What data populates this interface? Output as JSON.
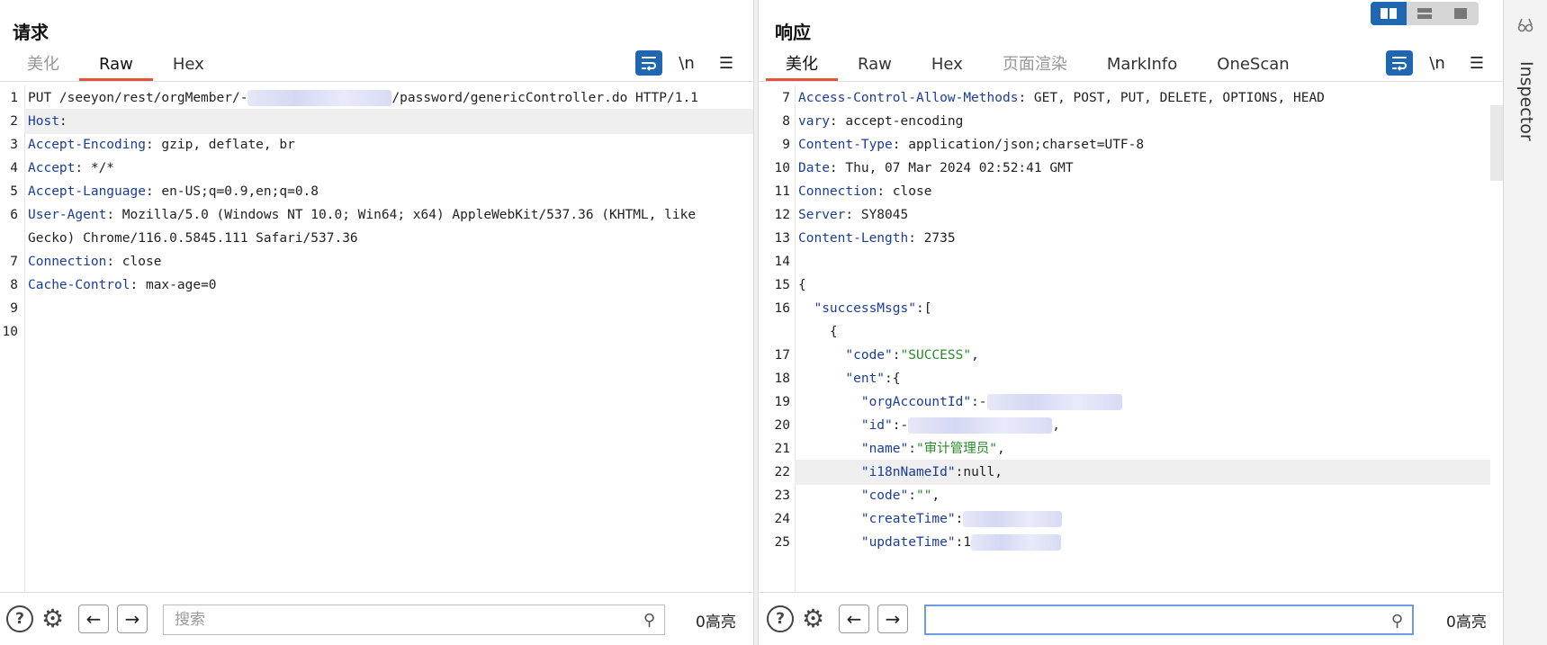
{
  "request": {
    "title": "请求",
    "tabs": [
      "美化",
      "Raw",
      "Hex"
    ],
    "lines": [
      {
        "n": "1",
        "segs": [
          [
            "v",
            "PUT /seeyon/rest/orgMember/-"
          ],
          [
            "blur",
            ""
          ],
          [
            "v",
            "/password/genericController.do HTTP/1.1"
          ]
        ]
      },
      {
        "n": "2",
        "segs": [
          [
            "k",
            "Host"
          ],
          [
            "v",
            ":"
          ]
        ]
      },
      {
        "n": "3",
        "segs": [
          [
            "k",
            "Accept-Encoding"
          ],
          [
            "v",
            ": gzip, deflate, br"
          ]
        ]
      },
      {
        "n": "4",
        "segs": [
          [
            "k",
            "Accept"
          ],
          [
            "v",
            ": */*"
          ]
        ]
      },
      {
        "n": "5",
        "segs": [
          [
            "k",
            "Accept-Language"
          ],
          [
            "v",
            ": en-US;q=0.9,en;q=0.8"
          ]
        ]
      },
      {
        "n": "6",
        "segs": [
          [
            "k",
            "User-Agent"
          ],
          [
            "v",
            ": Mozilla/5.0 (Windows NT 10.0; Win64; x64) AppleWebKit/537.36 (KHTML, like"
          ]
        ]
      },
      {
        "n": "",
        "segs": [
          [
            "v",
            "Gecko) Chrome/116.0.5845.111 Safari/537.36"
          ]
        ]
      },
      {
        "n": "7",
        "segs": [
          [
            "k",
            "Connection"
          ],
          [
            "v",
            ": close"
          ]
        ]
      },
      {
        "n": "8",
        "segs": [
          [
            "k",
            "Cache-Control"
          ],
          [
            "v",
            ": max-age=0"
          ]
        ]
      },
      {
        "n": "9",
        "segs": []
      },
      {
        "n": "10",
        "segs": []
      }
    ],
    "search_placeholder": "搜索",
    "highlight_count": "0高亮"
  },
  "response": {
    "title": "响应",
    "tabs": [
      "美化",
      "Raw",
      "Hex",
      "页面渲染",
      "MarkInfo",
      "OneScan"
    ],
    "lines": [
      {
        "n": "7",
        "segs": [
          [
            "k",
            "Access-Control-Allow-Methods"
          ],
          [
            "v",
            ": GET, POST, PUT, DELETE, OPTIONS, HEAD"
          ]
        ]
      },
      {
        "n": "8",
        "segs": [
          [
            "k",
            "vary"
          ],
          [
            "v",
            ": accept-encoding"
          ]
        ]
      },
      {
        "n": "9",
        "segs": [
          [
            "k",
            "Content-Type"
          ],
          [
            "v",
            ": application/json;charset=UTF-8"
          ]
        ]
      },
      {
        "n": "10",
        "segs": [
          [
            "k",
            "Date"
          ],
          [
            "v",
            ": Thu, 07 Mar 2024 02:52:41 GMT"
          ]
        ]
      },
      {
        "n": "11",
        "segs": [
          [
            "k",
            "Connection"
          ],
          [
            "v",
            ": close"
          ]
        ]
      },
      {
        "n": "12",
        "segs": [
          [
            "k",
            "Server"
          ],
          [
            "v",
            ": SY8045"
          ]
        ]
      },
      {
        "n": "13",
        "segs": [
          [
            "k",
            "Content-Length"
          ],
          [
            "v",
            ": 2735"
          ]
        ]
      },
      {
        "n": "14",
        "segs": []
      },
      {
        "n": "15",
        "segs": [
          [
            "v",
            "{"
          ]
        ]
      },
      {
        "n": "16",
        "segs": [
          [
            "v",
            "  "
          ],
          [
            "jk",
            "\"successMsgs\""
          ],
          [
            "v",
            ":["
          ]
        ]
      },
      {
        "n": "",
        "segs": [
          [
            "v",
            "    {"
          ]
        ]
      },
      {
        "n": "17",
        "segs": [
          [
            "v",
            "      "
          ],
          [
            "jk",
            "\"code\""
          ],
          [
            "v",
            ":"
          ],
          [
            "s",
            "\"SUCCESS\""
          ],
          [
            "v",
            ","
          ]
        ]
      },
      {
        "n": "18",
        "segs": [
          [
            "v",
            "      "
          ],
          [
            "jk",
            "\"ent\""
          ],
          [
            "v",
            ":{"
          ]
        ]
      },
      {
        "n": "19",
        "segs": [
          [
            "v",
            "        "
          ],
          [
            "jk",
            "\"orgAccountId\""
          ],
          [
            "v",
            ":-"
          ],
          [
            "blur",
            ""
          ]
        ]
      },
      {
        "n": "20",
        "segs": [
          [
            "v",
            "        "
          ],
          [
            "jk",
            "\"id\""
          ],
          [
            "v",
            ":-"
          ],
          [
            "blur",
            ""
          ],
          [
            "v",
            ","
          ]
        ]
      },
      {
        "n": "21",
        "segs": [
          [
            "v",
            "        "
          ],
          [
            "jk",
            "\"name\""
          ],
          [
            "v",
            ":"
          ],
          [
            "s",
            "\"审计管理员\""
          ],
          [
            "v",
            ","
          ]
        ]
      },
      {
        "n": "22",
        "segs": [
          [
            "v",
            "        "
          ],
          [
            "jk",
            "\"i18nNameId\""
          ],
          [
            "v",
            ":null,"
          ]
        ]
      },
      {
        "n": "23",
        "segs": [
          [
            "v",
            "        "
          ],
          [
            "jk",
            "\"code\""
          ],
          [
            "v",
            ":"
          ],
          [
            "s",
            "\"\""
          ],
          [
            "v",
            ","
          ]
        ]
      },
      {
        "n": "24",
        "segs": [
          [
            "v",
            "        "
          ],
          [
            "jk",
            "\"createTime\""
          ],
          [
            "v",
            ":"
          ],
          [
            "blur",
            ""
          ]
        ]
      },
      {
        "n": "25",
        "segs": [
          [
            "v",
            "        "
          ],
          [
            "jk",
            "\"updateTime\""
          ],
          [
            "v",
            ":1"
          ],
          [
            "blur",
            ""
          ]
        ]
      }
    ],
    "search_placeholder": "",
    "highlight_count": "0高亮"
  },
  "toolbar": {
    "wrap_icon": "wrap-lines-icon",
    "newline_label": "\\n",
    "menu_icon": "hamburger-menu-icon"
  },
  "inspector": {
    "label": "Inspector"
  },
  "colors": {
    "accent": "#1f67b1",
    "active_tab_underline": "#e3553a",
    "header_key": "#1a3d9c",
    "string": "#2a8a2a"
  }
}
